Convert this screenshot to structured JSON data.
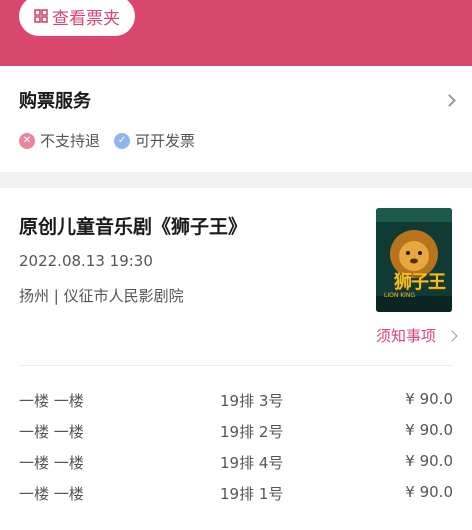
{
  "header": {
    "wallet_button_label": "查看票夹",
    "accent_color": "#d9476e"
  },
  "service": {
    "title": "购票服务",
    "tags": [
      {
        "icon": "x-circle-icon",
        "label": "不支持退"
      },
      {
        "icon": "check-circle-icon",
        "label": "可开发票"
      }
    ]
  },
  "show": {
    "title": "原创儿童音乐剧《狮子王》",
    "datetime": "2022.08.13 19:30",
    "venue": "扬州 | 仪征市人民影剧院",
    "poster": {
      "title": "狮子王",
      "subtitle": "LION KING"
    },
    "notice_label": "须知事项"
  },
  "tickets": [
    {
      "area": "一楼 一楼",
      "seat": "19排 3号",
      "price": "¥ 90.0"
    },
    {
      "area": "一楼 一楼",
      "seat": "19排 2号",
      "price": "¥ 90.0"
    },
    {
      "area": "一楼 一楼",
      "seat": "19排 4号",
      "price": "¥ 90.0"
    },
    {
      "area": "一楼 一楼",
      "seat": "19排 1号",
      "price": "¥ 90.0"
    }
  ]
}
